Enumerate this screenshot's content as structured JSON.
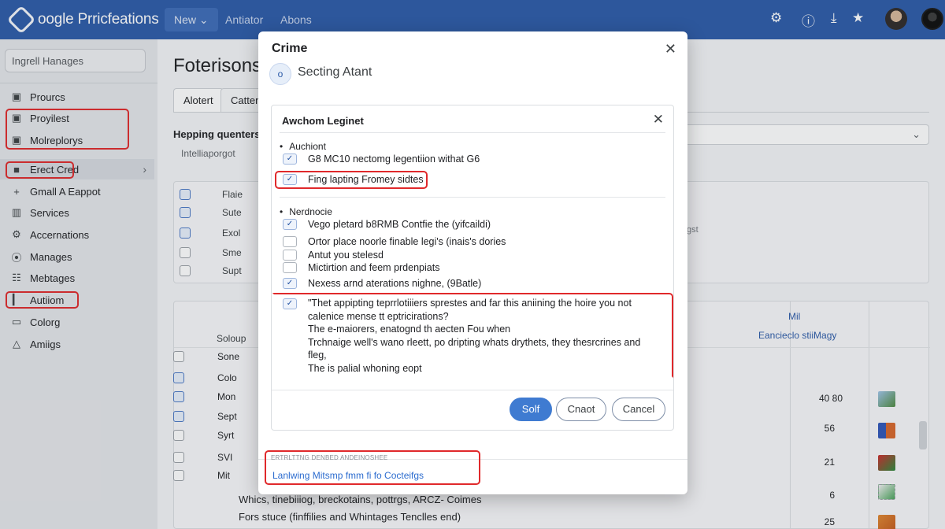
{
  "app": {
    "title": "oogle Prricfeations",
    "nav": {
      "new_label": "New",
      "links": [
        "Antiator",
        "Abons"
      ]
    },
    "icons": [
      "gear-icon",
      "info-icon",
      "download-icon",
      "star-icon"
    ]
  },
  "sidebar": {
    "search_placeholder": "Ingrell Hanages",
    "items": [
      {
        "label": "Prourcs",
        "icon": "▣"
      },
      {
        "label": "Proyilest",
        "icon": "▣"
      },
      {
        "label": "Molreplorys",
        "icon": "▣"
      },
      {
        "label": "Erect Cred",
        "icon": "■"
      },
      {
        "label": "Gmall A Eappot",
        "icon": "+"
      },
      {
        "label": "Services",
        "icon": "▥"
      },
      {
        "label": "Accernations",
        "icon": "⚙"
      },
      {
        "label": "Manages",
        "icon": "⦿"
      },
      {
        "label": "Mebtages",
        "icon": "☷"
      },
      {
        "label": "Autiiom",
        "icon": "▎"
      },
      {
        "label": "Colorg",
        "icon": "▭"
      },
      {
        "label": "Amiigs",
        "icon": "△"
      }
    ]
  },
  "main": {
    "page_title": "Foterisons",
    "tabs": [
      "Alotert",
      "Catten"
    ],
    "section_heading": "Hepping quenters",
    "section_sub": "Intelliaporgot",
    "rows": [
      "Flaie",
      "Sute",
      "Exol",
      "Sme",
      "Supt"
    ],
    "unit": "gst",
    "table": {
      "header_left": "Soloup",
      "header_mid": "Mil",
      "header_mid_sub": "Eancieclo stiiMagy",
      "rows": [
        {
          "label": "Sone",
          "value": ""
        },
        {
          "label": "Colo",
          "value": ""
        },
        {
          "label": "Mon",
          "value": "40 80"
        },
        {
          "label": "Sept",
          "value": "56"
        },
        {
          "label": "Syrt",
          "value": ""
        },
        {
          "label": "SVI",
          "value": "21"
        },
        {
          "label": "Mit",
          "value": ""
        }
      ],
      "footer_lines": [
        "Whics, tinebiiiog, breckotains, pottrgs, ARCZ- Coimes",
        "Fors stuce (finffilies and Whintages Tenclles end)"
      ],
      "footer_values": [
        "6",
        "25"
      ]
    }
  },
  "dialog": {
    "title": "Crime",
    "step_badge": "o",
    "step_text": "Secting Atant",
    "inner": {
      "title": "Awchom Leginet",
      "group1_label": "Auchiont",
      "group1_options": [
        {
          "label": "G8 MC10 nectomg legentiion withat G6",
          "checked": true
        },
        {
          "label": "Fing lapting Fromey sidtes",
          "checked": true
        }
      ],
      "group2_label": "Nerdnocie",
      "group2_options": [
        {
          "label": "Vego pletard b8RMB Contfie the (yifcaildi)",
          "checked": true
        },
        {
          "label": "Ortor place noorle finable legi's (inais's dories",
          "checked": false
        },
        {
          "label": "Antut you stelesd",
          "checked": false
        },
        {
          "label": "Mictirtion and feem prdenpiats",
          "checked": false
        },
        {
          "label": "Nexess arnd aterations nighne, (9Batle)",
          "checked": true
        }
      ],
      "textarea_lines": [
        "\"Thet appipting teprrlotiiiers sprestes and far this aniining the hoire you not",
        "calenice mense tt eptricirations?",
        "The e-maiorers, enatognd th aecten Fou when",
        "Trchnaige well's wano rleett, po dripting whats drythets, they thesrcrines and",
        "fleg,",
        "The is palial whoning eopt"
      ]
    },
    "buttons": {
      "primary": "Solf",
      "secondary": "Cnaot",
      "cancel": "Cancel"
    },
    "footer_hint": "ERTRLTTNG DENBED ANDEINOSHEE",
    "footer_link": "Lanlwing Mitsmp fmm fi fo Cocteifgs"
  }
}
